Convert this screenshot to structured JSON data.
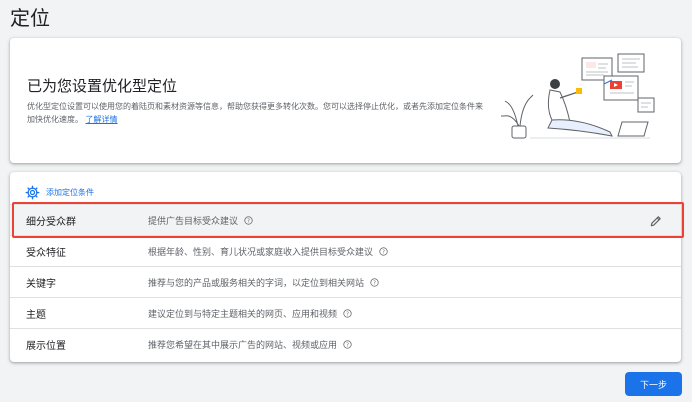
{
  "page": {
    "title": "定位"
  },
  "optimization": {
    "heading": "已为您设置优化型定位",
    "description": "优化型定位设置可以使用您的着陆页和素材资源等信息，帮助您获得更多转化次数。您可以选择停止优化，或者先添加定位条件来加快优化速度。",
    "learn_more": "了解详情"
  },
  "targeting": {
    "add_label": "添加定位条件",
    "rows": [
      {
        "name": "细分受众群",
        "desc": "提供广告目标受众建议"
      },
      {
        "name": "受众特征",
        "desc": "根据年龄、性别、育儿状况或家庭收入提供目标受众建议"
      },
      {
        "name": "关键字",
        "desc": "推荐与您的产品或服务相关的字词，以定位到相关网站"
      },
      {
        "name": "主题",
        "desc": "建议定位到与特定主题相关的网页、应用和视频"
      },
      {
        "name": "展示位置",
        "desc": "推荐您希望在其中展示广告的网站、视频或应用"
      }
    ]
  },
  "footer": {
    "next_label": "下一步"
  },
  "colors": {
    "accent": "#1a73e8",
    "highlight": "#ea4335"
  }
}
